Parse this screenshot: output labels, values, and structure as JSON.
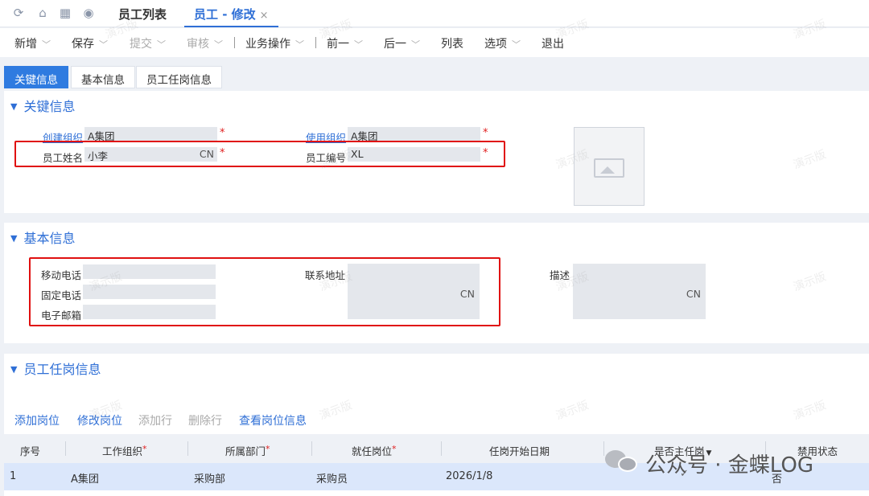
{
  "top_tabs": [
    "员工列表",
    "员工 - 修改"
  ],
  "close_glyph": "×",
  "toolbar": [
    {
      "label": "新增",
      "disabled": false
    },
    {
      "label": "保存",
      "disabled": false
    },
    {
      "label": "提交",
      "disabled": true
    },
    {
      "label": "审核",
      "disabled": true
    },
    {
      "label": "业务操作",
      "disabled": false
    },
    {
      "label": "前一",
      "disabled": false
    },
    {
      "label": "后一",
      "disabled": false
    },
    {
      "label": "列表",
      "disabled": false
    },
    {
      "label": "选项",
      "disabled": false
    },
    {
      "label": "退出",
      "disabled": false
    }
  ],
  "section_tabs": [
    "关键信息",
    "基本信息",
    "员工任岗信息"
  ],
  "key_info": {
    "title": "关键信息",
    "create_org_label": "创建组织",
    "create_org_value": "A集团",
    "use_org_label": "使用组织",
    "use_org_value": "A集团",
    "name_label": "员工姓名",
    "name_value": "小李",
    "name_lang": "CN",
    "code_label": "员工编号",
    "code_value": "XL",
    "required_mark": "*"
  },
  "basic_info": {
    "title": "基本信息",
    "mobile_label": "移动电话",
    "phone_label": "固定电话",
    "email_label": "电子邮箱",
    "address_label": "联系地址",
    "address_lang": "CN",
    "desc_label": "描述",
    "desc_lang": "CN"
  },
  "post_info": {
    "title": "员工任岗信息",
    "actions": [
      {
        "label": "添加岗位",
        "disabled": false
      },
      {
        "label": "修改岗位",
        "disabled": false
      },
      {
        "label": "添加行",
        "disabled": true
      },
      {
        "label": "删除行",
        "disabled": true
      },
      {
        "label": "查看岗位信息",
        "disabled": false
      }
    ],
    "columns": [
      "序号",
      "工作组织",
      "所属部门",
      "就任岗位",
      "任岗开始日期",
      "是否主任岗",
      "禁用状态"
    ],
    "rows": [
      [
        "1",
        "A集团",
        "采购部",
        "采购员",
        "2026/1/8",
        "✓",
        "否"
      ]
    ]
  },
  "watermark_text": "演示版",
  "wechat_text": "公众号 · 金蝶LOG",
  "colors": {
    "accent": "#2f6fd6",
    "highlight_box": "#e01010",
    "selected_row": "#dbe7fb"
  }
}
